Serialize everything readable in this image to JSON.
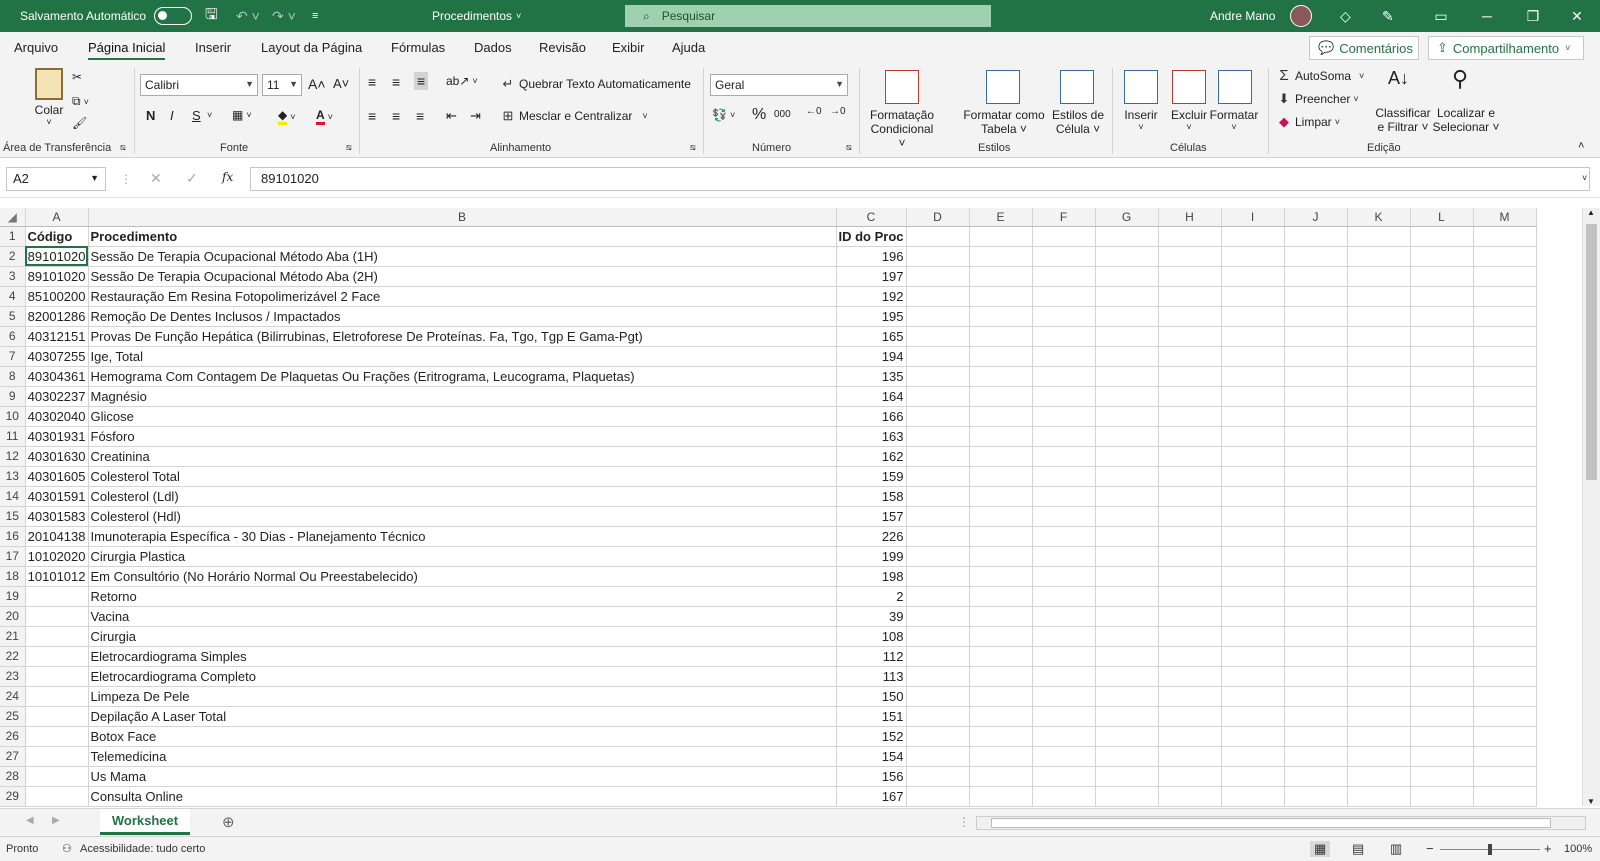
{
  "titlebar": {
    "autosave_label": "Salvamento Automático",
    "doc_title": "Procedimentos",
    "search_placeholder": "Pesquisar",
    "user_name": "Andre Mano"
  },
  "menu": {
    "tabs": [
      "Arquivo",
      "Página Inicial",
      "Inserir",
      "Layout da Página",
      "Fórmulas",
      "Dados",
      "Revisão",
      "Exibir",
      "Ajuda"
    ],
    "comments": "Comentários",
    "share": "Compartilhamento"
  },
  "ribbon": {
    "clipboard": {
      "paste": "Colar",
      "group": "Área de Transferência"
    },
    "font": {
      "name": "Calibri",
      "size": "11",
      "bold": "N",
      "italic": "I",
      "underline": "S",
      "group": "Fonte"
    },
    "alignment": {
      "wrap": "Quebrar Texto Automaticamente",
      "merge": "Mesclar e Centralizar",
      "group": "Alinhamento"
    },
    "number": {
      "format": "Geral",
      "percent": "%",
      "thousands": "000",
      "group": "Número"
    },
    "styles": {
      "conditional_1": "Formatação",
      "conditional_2": "Condicional",
      "table_1": "Formatar como",
      "table_2": "Tabela",
      "cell_1": "Estilos de",
      "cell_2": "Célula",
      "group": "Estilos"
    },
    "cells": {
      "insert": "Inserir",
      "delete": "Excluir",
      "format": "Formatar",
      "group": "Células"
    },
    "editing": {
      "autosum": "AutoSoma",
      "fill": "Preencher",
      "clear": "Limpar",
      "sort_1": "Classificar",
      "sort_2": "e Filtrar",
      "find_1": "Localizar e",
      "find_2": "Selecionar",
      "group": "Edição"
    }
  },
  "formula_bar": {
    "name_box": "A2",
    "fx": "fx",
    "value": "89101020"
  },
  "columns": [
    "A",
    "B",
    "C",
    "D",
    "E",
    "F",
    "G",
    "H",
    "I",
    "J",
    "K",
    "L",
    "M"
  ],
  "header_row": {
    "a": "Código",
    "b": "Procedimento",
    "c": "ID do Proc"
  },
  "rows": [
    {
      "n": "2",
      "a": "89101020",
      "b": "Sessão De Terapia Ocupacional Método Aba (1H)",
      "c": "196"
    },
    {
      "n": "3",
      "a": "89101020",
      "b": "Sessão De Terapia Ocupacional Método Aba (2H)",
      "c": "197"
    },
    {
      "n": "4",
      "a": "85100200",
      "b": "Restauração Em Resina Fotopolimerizável 2 Face",
      "c": "192"
    },
    {
      "n": "5",
      "a": "82001286",
      "b": "Remoção De Dentes Inclusos / Impactados",
      "c": "195"
    },
    {
      "n": "6",
      "a": "40312151",
      "b": "Provas De Função Hepática (Bilirrubinas, Eletroforese De Proteínas. Fa, Tgo, Tgp E Gama-Pgt)",
      "c": "165"
    },
    {
      "n": "7",
      "a": "40307255",
      "b": "Ige, Total",
      "c": "194"
    },
    {
      "n": "8",
      "a": "40304361",
      "b": "Hemograma Com Contagem De Plaquetas Ou Frações (Eritrograma, Leucograma, Plaquetas)",
      "c": "135"
    },
    {
      "n": "9",
      "a": "40302237",
      "b": "Magnésio",
      "c": "164"
    },
    {
      "n": "10",
      "a": "40302040",
      "b": "Glicose",
      "c": "166"
    },
    {
      "n": "11",
      "a": "40301931",
      "b": "Fósforo",
      "c": "163"
    },
    {
      "n": "12",
      "a": "40301630",
      "b": "Creatinina",
      "c": "162"
    },
    {
      "n": "13",
      "a": "40301605",
      "b": "Colesterol Total",
      "c": "159"
    },
    {
      "n": "14",
      "a": "40301591",
      "b": "Colesterol (Ldl)",
      "c": "158"
    },
    {
      "n": "15",
      "a": "40301583",
      "b": "Colesterol (Hdl)",
      "c": "157"
    },
    {
      "n": "16",
      "a": "20104138",
      "b": "Imunoterapia Específica - 30 Dias - Planejamento Técnico",
      "c": "226"
    },
    {
      "n": "17",
      "a": "10102020",
      "b": "Cirurgia Plastica",
      "c": "199"
    },
    {
      "n": "18",
      "a": "10101012",
      "b": "Em Consultório (No Horário Normal Ou Preestabelecido)",
      "c": "198"
    },
    {
      "n": "19",
      "a": "",
      "b": "Retorno",
      "c": "2"
    },
    {
      "n": "20",
      "a": "",
      "b": "Vacina",
      "c": "39"
    },
    {
      "n": "21",
      "a": "",
      "b": "Cirurgia",
      "c": "108"
    },
    {
      "n": "22",
      "a": "",
      "b": "Eletrocardiograma Simples",
      "c": "112"
    },
    {
      "n": "23",
      "a": "",
      "b": "Eletrocardiograma Completo",
      "c": "113"
    },
    {
      "n": "24",
      "a": "",
      "b": "Limpeza De Pele",
      "c": "150"
    },
    {
      "n": "25",
      "a": "",
      "b": "Depilação A Laser Total",
      "c": "151"
    },
    {
      "n": "26",
      "a": "",
      "b": "Botox Face",
      "c": "152"
    },
    {
      "n": "27",
      "a": "",
      "b": "Telemedicina",
      "c": "154"
    },
    {
      "n": "28",
      "a": "",
      "b": "Us Mama",
      "c": "156"
    },
    {
      "n": "29",
      "a": "",
      "b": "Consulta Online",
      "c": "167"
    }
  ],
  "sheet_tab": "Worksheet",
  "status": {
    "ready": "Pronto",
    "accessibility": "Acessibilidade: tudo certo",
    "zoom": "100%"
  },
  "colors": {
    "accent": "#217346",
    "selection": "#217346"
  }
}
